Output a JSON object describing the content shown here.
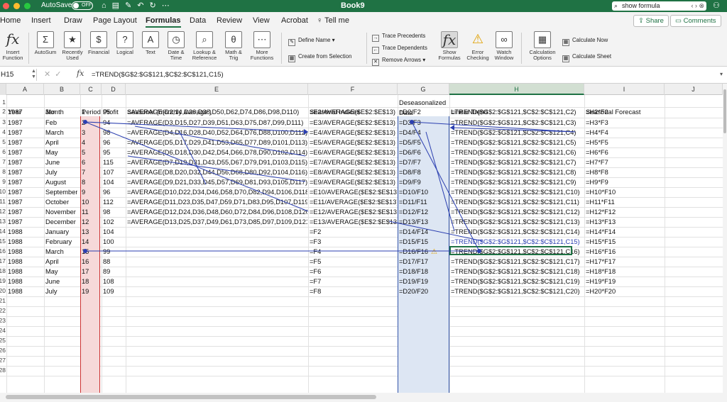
{
  "titlebar": {
    "autosave_label": "AutoSave",
    "autosave_state": "OFF",
    "doc_title": "Book9",
    "search_text": "show formula",
    "search_nav": "‹  ›",
    "icons": [
      "home-icon",
      "save-icon",
      "save-as-icon",
      "undo-icon",
      "redo-icon",
      "more-icon",
      "account-icon"
    ]
  },
  "tabs": [
    "Home",
    "Insert",
    "Draw",
    "Page Layout",
    "Formulas",
    "Data",
    "Review",
    "View",
    "Acrobat",
    "Tell me"
  ],
  "active_tab": "Formulas",
  "share_label": "Share",
  "comments_label": "Comments",
  "ribbon": {
    "insert_function": "Insert Function",
    "autosum": "AutoSum",
    "recently_used": "Recently Used",
    "financial": "Financial",
    "logical": "Logical",
    "text": "Text",
    "date_time": "Date & Time",
    "lookup_reference": "Lookup & Reference",
    "math_trig": "Math & Trig",
    "more_functions": "More Functions",
    "define_name": "Define Name",
    "create_from_selection": "Create from Selection",
    "trace_precedents": "Trace Precedents",
    "trace_dependents": "Trace Dependents",
    "remove_arrows": "Remove Arrows",
    "show_formulas": "Show Formulas",
    "error_checking": "Error Checking",
    "watch_window": "Watch Window",
    "calculation_options": "Calculation Options",
    "calculate_now": "Calculate Now",
    "calculate_sheet": "Calculate Sheet"
  },
  "formula_bar": {
    "name_box": "H15",
    "fx": "fx",
    "formula": "=TREND($G$2:$G$121,$C$2:$C$121,C15)"
  },
  "columns": [
    "A",
    "B",
    "C",
    "D",
    "E",
    "F",
    "G",
    "H",
    "I",
    "J"
  ],
  "row_numbers": [
    "1",
    "2",
    "3",
    "4",
    "5",
    "6",
    "7",
    "8",
    "9",
    "10",
    "11",
    "12",
    "13",
    "14",
    "15",
    "16",
    "17",
    "18",
    "19",
    "20",
    "21",
    "22",
    "23",
    "24",
    "25",
    "26",
    "27",
    "28"
  ],
  "rows": [
    [
      "Year",
      "Month",
      "Period",
      "Profit",
      "Seasonal (monthly average )",
      "Seasonal Indices",
      "Deseasonalized Data",
      "Linear Trend",
      "Seasonal Forecast"
    ],
    [
      "1987",
      "Jan",
      "1",
      "95",
      "=AVERAGE(D2,14,D26,D38,D50,D62,D74,D86,D98,D110)",
      "=E2/AVERAGE($E$2:$E$13)",
      "=D2/F2",
      "=TREND($G$2:$G$121,$C$2:$C$121,C2)",
      "=H2*F2"
    ],
    [
      "1987",
      "Feb",
      "2",
      "94",
      "=AVERAGE(D3,D15,D27,D39,D51,D63,D75,D87,D99,D111)",
      "=E3/AVERAGE($E$2:$E$13)",
      "=D3/F3",
      "=TREND($G$2:$G$121,$C$2:$C$121,C3)",
      "=H3*F3"
    ],
    [
      "1987",
      "March",
      "3",
      "98",
      "=AVERAGE(D4,D16,D28,D40,D52,D64,D76,D88,D100,D112)",
      "=E4/AVERAGE($E$2:$E$13)",
      "=D4/F4",
      "=TREND($G$2:$G$121,$C$2:$C$121,C4)",
      "=H4*F4"
    ],
    [
      "1987",
      "April",
      "4",
      "96",
      "=AVERAGE(D5,D17,D29,D41,D53,D65,D77,D89,D101,D113)",
      "=E5/AVERAGE($E$2:$E$13)",
      "=D5/F5",
      "=TREND($G$2:$G$121,$C$2:$C$121,C5)",
      "=H5*F5"
    ],
    [
      "1987",
      "May",
      "5",
      "95",
      "=AVERAGE(D6,D18,D30,D42,D54,D66,D78,D90,D102,D114)",
      "=E6/AVERAGE($E$2:$E$13)",
      "=D6/F6",
      "=TREND($G$2:$G$121,$C$2:$C$121,C6)",
      "=H6*F6"
    ],
    [
      "1987",
      "June",
      "6",
      "115",
      "=AVERAGE(D7,D19,D31,D43,D55,D67,D79,D91,D103,D115)",
      "=E7/AVERAGE($E$2:$E$13)",
      "=D7/F7",
      "=TREND($G$2:$G$121,$C$2:$C$121,C7)",
      "=H7*F7"
    ],
    [
      "1987",
      "July",
      "7",
      "107",
      "=AVERAGE(D8,D20,D32,D44,D56,D68,D80,D92,D104,D116)",
      "=E8/AVERAGE($E$2:$E$13)",
      "=D8/F8",
      "=TREND($G$2:$G$121,$C$2:$C$121,C8)",
      "=H8*F8"
    ],
    [
      "1987",
      "August",
      "8",
      "104",
      "=AVERAGE(D9,D21,D33,D45,D57,D69,D81,D93,D105,D117)",
      "=E9/AVERAGE($E$2:$E$13)",
      "=D9/F9",
      "=TREND($G$2:$G$121,$C$2:$C$121,C9)",
      "=H9*F9"
    ],
    [
      "1987",
      "September",
      "9",
      "96",
      "=AVERAGE(D10,D22,D34,D46,D58,D70,D82,D94,D106,D118)",
      "=E10/AVERAGE($E$2:$E$13)",
      "=D10/F10",
      "=TREND($G$2:$G$121,$C$2:$C$121,C10)",
      "=H10*F10"
    ],
    [
      "1987",
      "October",
      "10",
      "112",
      "=AVERAGE(D11,D23,D35,D47,D59,D71,D83,D95,D107,D119)",
      "=E11/AVERAGE($E$2:$E$13)",
      "=D11/F11",
      "=TREND($G$2:$G$121,$C$2:$C$121,C11)",
      "=H11*F11"
    ],
    [
      "1987",
      "November",
      "11",
      "98",
      "=AVERAGE(D12,D24,D36,D48,D60,D72,D84,D96,D108,D120)",
      "=E12/AVERAGE($E$2:$E$13)",
      "=D12/F12",
      "=TREND($G$2:$G$121,$C$2:$C$121,C12)",
      "=H12*F12"
    ],
    [
      "1987",
      "December",
      "12",
      "102",
      "=AVERAGE(D13,D25,D37,D49,D61,D73,D85,D97,D109,D121)",
      "=E13/AVERAGE($E$2:$E$13)",
      "=D13/F13",
      "=TREND($G$2:$G$121,$C$2:$C$121,C13)",
      "=H13*F13"
    ],
    [
      "1988",
      "January",
      "13",
      "104",
      "",
      "=F2",
      "=D14/F14",
      "=TREND($G$2:$G$121,$C$2:$C$121,C14)",
      "=H14*F14"
    ],
    [
      "1988",
      "February",
      "14",
      "100",
      "",
      "=F3",
      "=D15/F15",
      "=TREND($G$2:$G$121,$C$2:$C$121,C15)",
      "=H15*F15"
    ],
    [
      "1988",
      "March",
      "15",
      "99",
      "",
      "=F4",
      "=D16/F16",
      "=TREND($G$2:$G$121,$C$2:$C$121,C16)",
      "=H16*F16"
    ],
    [
      "1988",
      "April",
      "16",
      "88",
      "",
      "=F5",
      "=D17/F17",
      "=TREND($G$2:$G$121,$C$2:$C$121,C17)",
      "=H17*F17"
    ],
    [
      "1988",
      "May",
      "17",
      "89",
      "",
      "=F6",
      "=D18/F18",
      "=TREND($G$2:$G$121,$C$2:$C$121,C18)",
      "=H18*F18"
    ],
    [
      "1988",
      "June",
      "18",
      "108",
      "",
      "=F7",
      "=D19/F19",
      "=TREND($G$2:$G$121,$C$2:$C$121,C19)",
      "=H19*F19"
    ],
    [
      "1988",
      "July",
      "19",
      "109",
      "",
      "=F8",
      "=D20/F20",
      "=TREND($G$2:$G$121,$C$2:$C$121,C20)",
      "=H20*F20"
    ]
  ],
  "colors": {
    "excel_green": "#1f7244",
    "trace_blue": "#2b3fb0",
    "precedent_red": "#c33333"
  }
}
